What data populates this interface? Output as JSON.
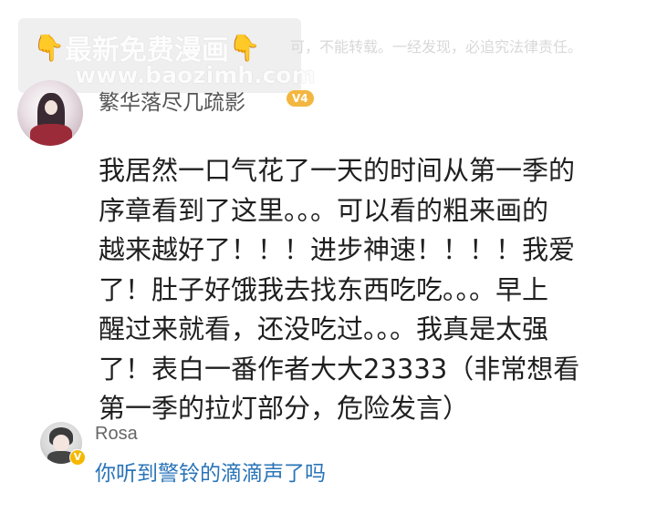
{
  "watermark": {
    "line1": "最新免费漫画",
    "line2": "www.baozimh.com",
    "hand_icon": "pointing-hand-emoji"
  },
  "notice": "可，不能转载。一经发现，必追究法律责任。",
  "comment": {
    "username": "繁华落尽几疏影",
    "level_badge": "V4",
    "lines": [
      "我居然一口气花了一天的时间从第一季的",
      "序章看到了这里。。。可以看的粗来画的",
      "越来越好了！！！进步神速！！！！我爱",
      "了！肚子好饿我去找东西吃吃。。。早上",
      "醒过来就看，还没吃过。。。我真是太强",
      "了！表白一番作者大大23333（非常想看",
      "第一季的拉灯部分，危险发言）"
    ]
  },
  "reply": {
    "username": "Rosa",
    "verified_mark": "V",
    "text": "你听到警铃的滴滴声了吗"
  },
  "colors": {
    "reply_text": "#2a74b8",
    "badge": "#f3b640",
    "watermark_hand": "#f6b400"
  }
}
